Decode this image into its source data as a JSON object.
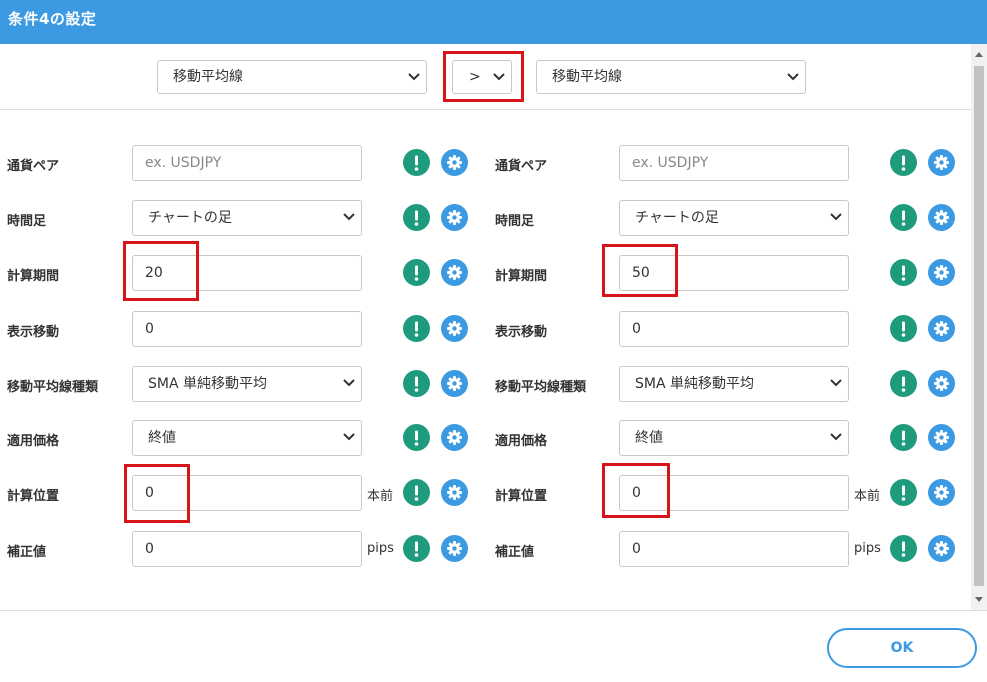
{
  "header": {
    "title": "条件4の設定"
  },
  "top": {
    "left_select": "移動平均線",
    "operator": ">",
    "right_select": "移動平均線"
  },
  "left": [
    {
      "label": "通貨ペア",
      "value": "",
      "placeholder": "ex. USDJPY",
      "type": "input",
      "unit": ""
    },
    {
      "label": "時間足",
      "value": "チャートの足",
      "type": "select",
      "unit": ""
    },
    {
      "label": "計算期間",
      "value": "20",
      "type": "input",
      "unit": ""
    },
    {
      "label": "表示移動",
      "value": "0",
      "type": "input",
      "unit": ""
    },
    {
      "label": "移動平均線種類",
      "value": "SMA 単純移動平均",
      "type": "select",
      "unit": ""
    },
    {
      "label": "適用価格",
      "value": "終値",
      "type": "select",
      "unit": ""
    },
    {
      "label": "計算位置",
      "value": "0",
      "type": "input",
      "unit": "本前"
    },
    {
      "label": "補正値",
      "value": "0",
      "type": "input",
      "unit": "pips"
    }
  ],
  "right": [
    {
      "label": "通貨ペア",
      "value": "",
      "placeholder": "ex. USDJPY",
      "type": "input",
      "unit": ""
    },
    {
      "label": "時間足",
      "value": "チャートの足",
      "type": "select",
      "unit": ""
    },
    {
      "label": "計算期間",
      "value": "50",
      "type": "input",
      "unit": ""
    },
    {
      "label": "表示移動",
      "value": "0",
      "type": "input",
      "unit": ""
    },
    {
      "label": "移動平均線種類",
      "value": "SMA 単純移動平均",
      "type": "select",
      "unit": ""
    },
    {
      "label": "適用価格",
      "value": "終値",
      "type": "select",
      "unit": ""
    },
    {
      "label": "計算位置",
      "value": "0",
      "type": "input",
      "unit": "本前"
    },
    {
      "label": "補正値",
      "value": "0",
      "type": "input",
      "unit": "pips"
    }
  ],
  "icons": {
    "alert": "exclamation-icon",
    "settings": "gear-icon"
  },
  "colors": {
    "header": "#3b9ae1",
    "alert": "#1e9b7c",
    "gear": "#3b9ae1",
    "highlight": "#d8141b"
  },
  "footer": {
    "ok_label": "OK"
  }
}
